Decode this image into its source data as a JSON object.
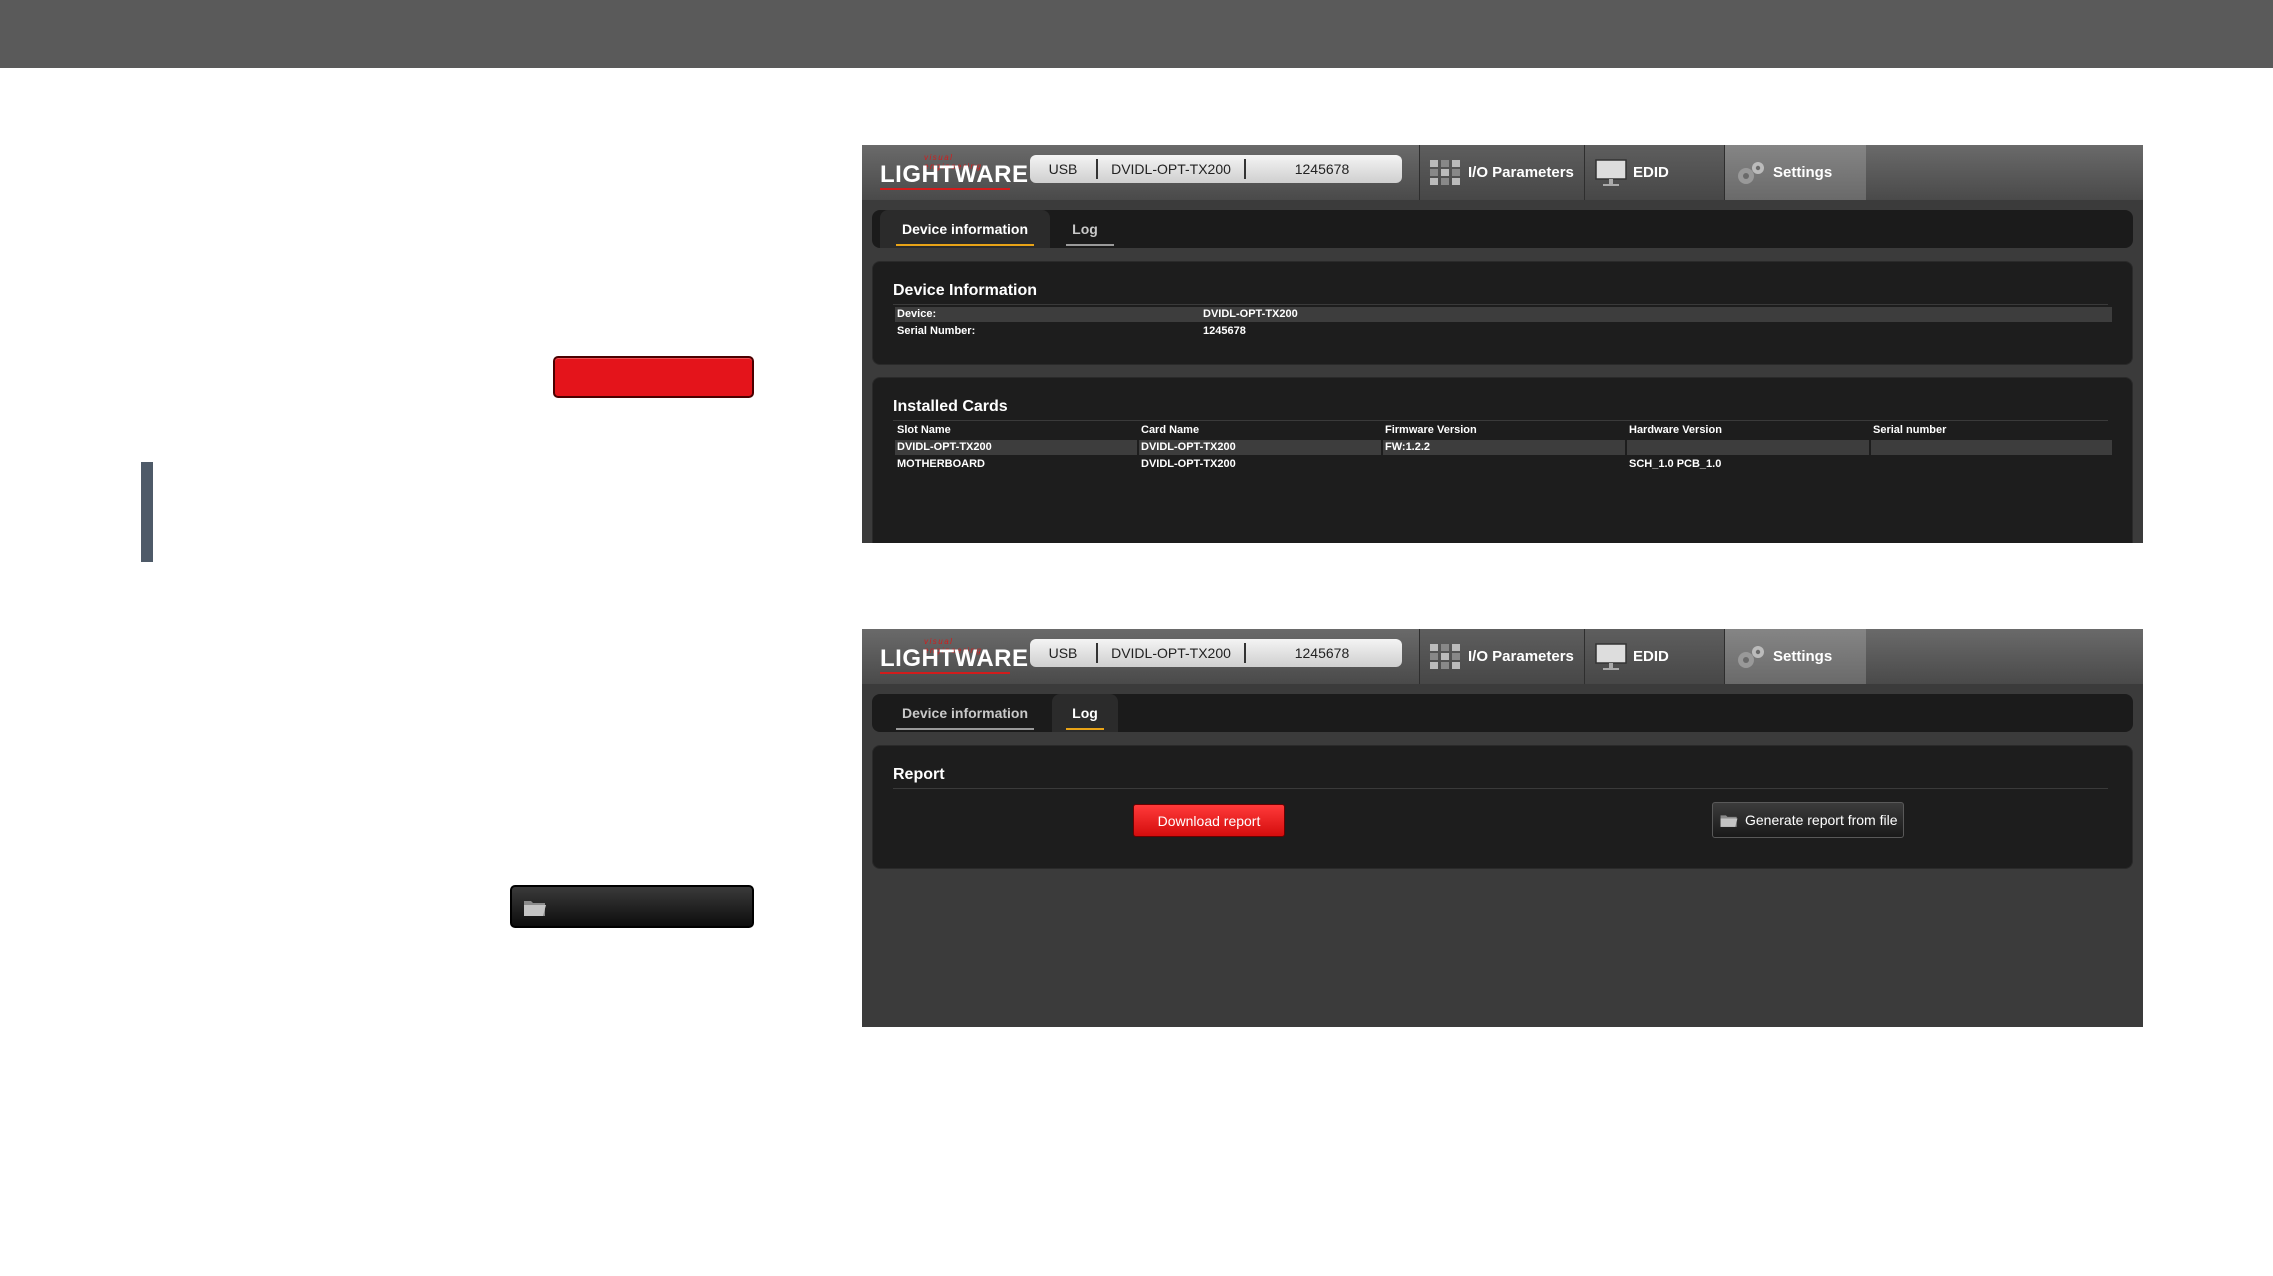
{
  "apps": [
    {
      "header": {
        "logo_small": "visual engineering",
        "logo_big": "LIGHTWARE",
        "connection": {
          "type": "USB",
          "device": "DVIDL-OPT-TX200",
          "serial": "1245678"
        },
        "nav": {
          "io": "I/O Parameters",
          "edid": "EDID",
          "settings": "Settings"
        }
      },
      "subtabs": {
        "device_info": "Device information",
        "log": "Log"
      },
      "device_information": {
        "title": "Device Information",
        "rows": [
          {
            "label": "Device:",
            "value": "DVIDL-OPT-TX200"
          },
          {
            "label": "Serial Number:",
            "value": "1245678"
          }
        ]
      },
      "installed_cards": {
        "title": "Installed Cards",
        "headers": [
          "Slot Name",
          "Card Name",
          "Firmware Version",
          "Hardware Version",
          "Serial number"
        ],
        "rows": [
          [
            "DVIDL-OPT-TX200",
            "DVIDL-OPT-TX200",
            "FW:1.2.2",
            "",
            ""
          ],
          [
            "MOTHERBOARD",
            "DVIDL-OPT-TX200",
            "",
            "SCH_1.0 PCB_1.0",
            ""
          ]
        ]
      }
    },
    {
      "header": {
        "logo_small": "visual engineering",
        "logo_big": "LIGHTWARE",
        "connection": {
          "type": "USB",
          "device": "DVIDL-OPT-TX200",
          "serial": "1245678"
        },
        "nav": {
          "io": "I/O Parameters",
          "edid": "EDID",
          "settings": "Settings"
        }
      },
      "subtabs": {
        "device_info": "Device information",
        "log": "Log"
      },
      "report": {
        "title": "Report",
        "download_label": "Download report",
        "generate_label": "Generate report from file"
      }
    }
  ],
  "colors": {
    "accent_red": "#e4141b",
    "tab_underline": "#e8a317",
    "topbar": "#5a5a5a"
  }
}
